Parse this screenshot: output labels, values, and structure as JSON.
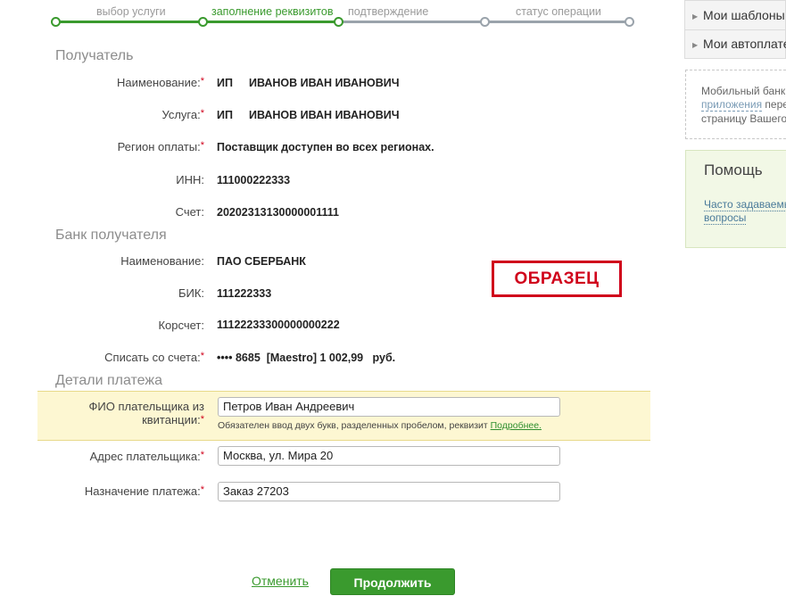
{
  "steps": {
    "step1": "выбор услуги",
    "step2": "заполнение реквизитов",
    "step3": "подтверждение",
    "step4": "статус операции"
  },
  "recipient": {
    "section_title": "Получатель",
    "name_label": "Наименование:",
    "name_value_prefix": "ИП",
    "name_value": "ИВАНОВ ИВАН ИВАНОВИЧ",
    "service_label": "Услуга:",
    "service_value_prefix": "ИП",
    "service_value": "ИВАНОВ ИВАН ИВАНОВИЧ",
    "region_label": "Регион оплаты:",
    "region_value": "Поставщик доступен во всех регионах.",
    "inn_label": "ИНН:",
    "inn_value": "111000222333",
    "account_label": "Счет:",
    "account_value": "20202313130000001111"
  },
  "bank": {
    "section_title": "Банк получателя",
    "name_label": "Наименование:",
    "name_value": "ПАО СБЕРБАНК",
    "bik_label": "БИК:",
    "bik_value": "111222333",
    "corr_label": "Корсчет:",
    "corr_value": "11122233300000000222",
    "debit_label": "Списать со счета:",
    "debit_value": "•••• 8685  [Maestro] 1 002,99   руб."
  },
  "details": {
    "section_title": "Детали платежа",
    "payer_label_line1": "ФИО плательщика из",
    "payer_label_line2": "квитанции:",
    "payer_value": "Петров Иван Андреевич",
    "payer_hint": "Обязателен ввод двух букв, разделенных пробелом, реквизит",
    "payer_hint_link": "Подробнее.",
    "address_label": "Адрес плательщика:",
    "address_value": "Москва, ул. Мира 20",
    "purpose_label": "Назначение платежа:",
    "purpose_value": "Заказ 27203"
  },
  "required_mark": "*",
  "stamp": "ОБРАЗЕЦ",
  "actions": {
    "cancel": "Отменить",
    "continue": "Продолжить"
  },
  "sidebar": {
    "templates": "Мои шаблоны",
    "autopayments": "Мои автоплатежи",
    "mobile_line1": "Мобильный банк",
    "mobile_line2_link": "приложения",
    "mobile_line2_rest": " перейти",
    "mobile_line3": "страницу Вашего",
    "help_title": "Помощь",
    "faq_line1": "Часто задаваемые",
    "faq_line2": "вопросы"
  },
  "colors": {
    "accent_green": "#3a9a2e",
    "required_red": "#d0021b",
    "highlight_yellow": "#fdf7d2"
  }
}
